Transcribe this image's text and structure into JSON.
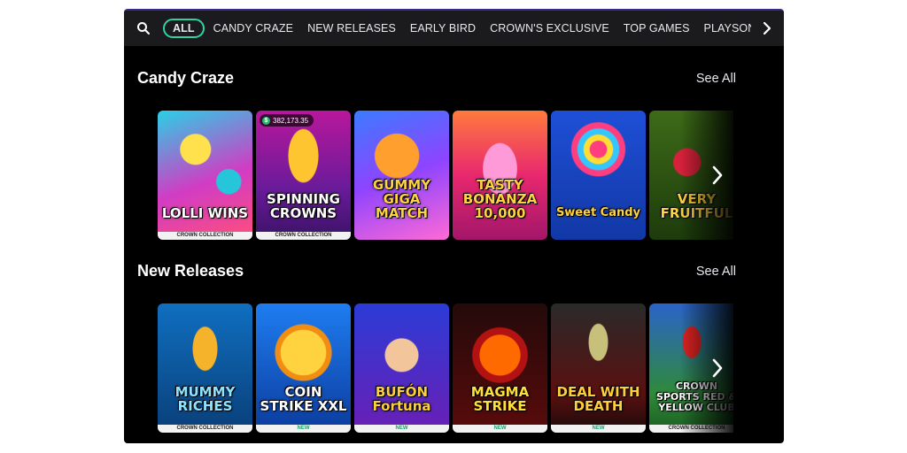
{
  "nav": {
    "items": [
      "ALL",
      "CANDY CRAZE",
      "NEW RELEASES",
      "EARLY BIRD",
      "CROWN'S EXCLUSIVE",
      "TOP GAMES",
      "PLAYSON JACK"
    ]
  },
  "sections": [
    {
      "title": "Candy Craze",
      "see_all": "See All",
      "cards": [
        {
          "title": "LOLLI WINS",
          "tag": "CROWN COLLECTION"
        },
        {
          "title": "SPINNING CROWNS",
          "tag": "CROWN COLLECTION",
          "jackpot": "382,173.35"
        },
        {
          "title": "GUMMY GIGA MATCH",
          "tag": ""
        },
        {
          "title": "TASTY BONANZA 10,000",
          "tag": ""
        },
        {
          "title": "Sweet Candy",
          "tag": ""
        },
        {
          "title": "VERY FRUITFUL",
          "tag": ""
        }
      ]
    },
    {
      "title": "New Releases",
      "see_all": "See All",
      "cards": [
        {
          "title": "MUMMY RICHES",
          "tag": "CROWN COLLECTION"
        },
        {
          "title": "COIN STRIKE XXL",
          "tag": "NEW"
        },
        {
          "title": "BUFÓN Fortuna",
          "tag": "NEW"
        },
        {
          "title": "MAGMA STRIKE",
          "tag": "NEW"
        },
        {
          "title": "DEAL WITH DEATH",
          "tag": "NEW"
        },
        {
          "title": "CROWN SPORTS RED & YELLOW CLUB",
          "tag": "CROWN COLLECTION"
        }
      ]
    }
  ],
  "colors": {
    "accent": "#2fd3a3",
    "panel": "#000000",
    "navbar": "#1b1b1d"
  }
}
